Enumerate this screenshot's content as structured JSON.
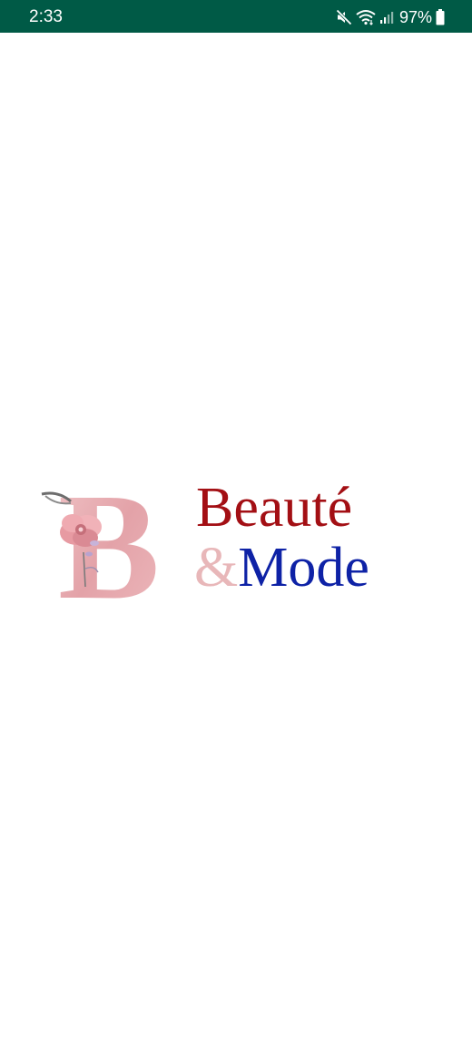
{
  "status_bar": {
    "time": "2:33",
    "battery": "97%",
    "icons": [
      "mute-icon",
      "wifi-icon",
      "signal-icon",
      "battery-icon"
    ],
    "background": "#005a46"
  },
  "logo": {
    "monogram": "B",
    "line1": "Beauté",
    "ampersand": "&",
    "line2": "Mode",
    "colors": {
      "beaute": "#a30f14",
      "ampersand": "#e8b7b9",
      "mode": "#0e22a6",
      "monogram": "#e6a8ae"
    }
  }
}
